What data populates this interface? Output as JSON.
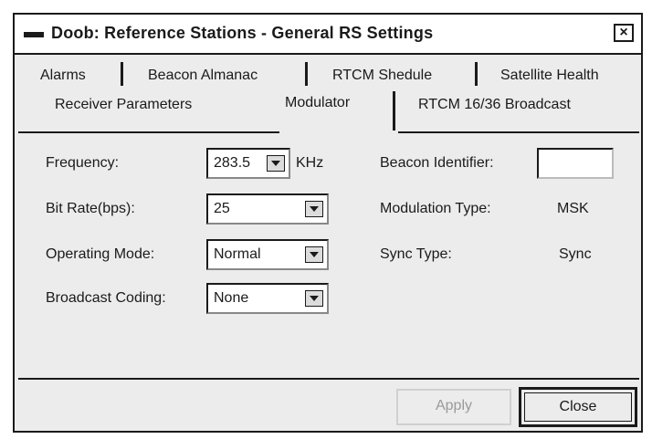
{
  "window": {
    "title": "Doob: Reference Stations - General RS Settings",
    "close_glyph": "×"
  },
  "tabs": {
    "row1": [
      "Alarms",
      "Beacon Almanac",
      "RTCM Shedule",
      "Satellite Health"
    ],
    "row2": [
      "Receiver Parameters",
      "Modulator",
      "RTCM 16/36 Broadcast"
    ],
    "active": "Modulator"
  },
  "form": {
    "frequency_label": "Frequency:",
    "frequency_value": "283.5",
    "frequency_unit": "KHz",
    "bitrate_label": "Bit Rate(bps):",
    "bitrate_value": "25",
    "opmode_label": "Operating Mode:",
    "opmode_value": "Normal",
    "coding_label": "Broadcast Coding:",
    "coding_value": "None",
    "beacon_id_label": "Beacon Identifier:",
    "beacon_id_value": "",
    "modulation_label": "Modulation Type:",
    "modulation_value": "MSK",
    "sync_label": "Sync Type:",
    "sync_value": "Sync"
  },
  "buttons": {
    "apply": "Apply",
    "close": "Close"
  },
  "icons": {
    "window": "window-menu-icon",
    "close": "close-icon",
    "dropdown": "chevron-down-icon"
  }
}
